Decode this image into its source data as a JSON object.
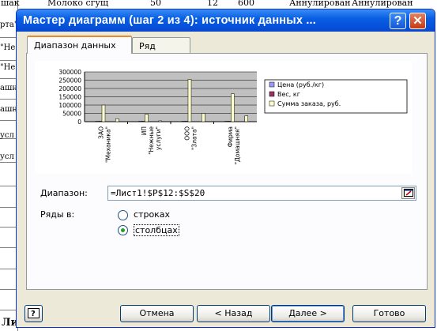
{
  "sheet": {
    "top_fragments": [
      "шак",
      "Молоко сгущ",
      "50",
      "12",
      "600",
      "Аннулирован",
      "Аннулирован"
    ],
    "left_fragments": [
      "рта\"",
      "\"Не",
      "\"Не",
      "ашн",
      "ашн",
      "усл",
      "усл"
    ],
    "bottom_fragment": "Ли"
  },
  "dialog": {
    "title": "Мастер диаграмм (шаг 2 из 4): источник данных ...",
    "help_glyph": "?",
    "close_glyph": "✕",
    "tabs": [
      {
        "label": "Диапазон данных",
        "selected": true
      },
      {
        "label": "Ряд",
        "selected": false
      }
    ],
    "range_label": "Диапазон:",
    "range_value": "=Лист1!$P$12:$S$20",
    "series_in_label": "Ряды в:",
    "radio_rows": {
      "label": "строках",
      "checked": false
    },
    "radio_cols": {
      "label": "столбцах",
      "checked": true
    },
    "buttons": {
      "cancel": "Отмена",
      "back": "< Назад",
      "next": "Далее >",
      "finish": "Готово"
    }
  },
  "chart_data": {
    "type": "bar",
    "categories": [
      "ЗАО \"Механика\"",
      "ИП \"Нежные услуги\"",
      "ООО \"Злата\"",
      "Фирма \"Домашняя\""
    ],
    "series": [
      {
        "name": "Цена (руб./кг)",
        "color": "#9999FF",
        "values": [
          600,
          500,
          400,
          300
        ]
      },
      {
        "name": "Вес, кг",
        "color": "#993366",
        "values": [
          300,
          300,
          300,
          300
        ]
      },
      {
        "name": "Сумма заказа, руб.",
        "color": "#FFFFCC",
        "values": [
          100000,
          45000,
          255000,
          168000
        ]
      }
    ],
    "extra_bars_series3": [
      18000,
      5000,
      50000,
      35000
    ],
    "ylim": [
      0,
      300000
    ],
    "yticks": [
      0,
      50000,
      100000,
      150000,
      200000,
      250000,
      300000
    ],
    "plot_background": "#C0C0C0",
    "legend_position": "right",
    "grid": true
  }
}
